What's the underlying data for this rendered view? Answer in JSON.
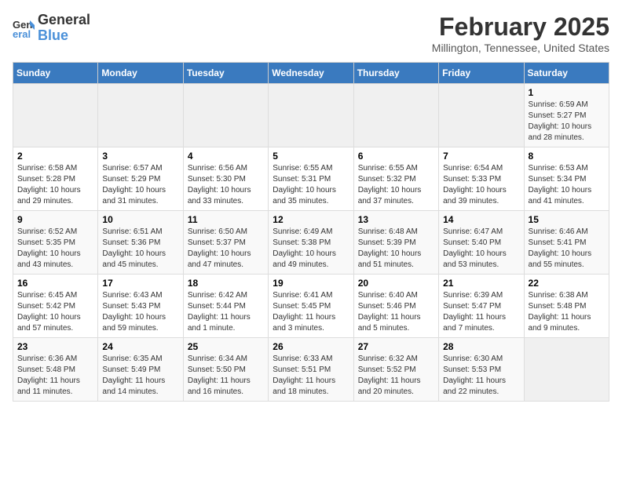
{
  "logo": {
    "line1": "General",
    "line2": "Blue"
  },
  "title": "February 2025",
  "subtitle": "Millington, Tennessee, United States",
  "days_of_week": [
    "Sunday",
    "Monday",
    "Tuesday",
    "Wednesday",
    "Thursday",
    "Friday",
    "Saturday"
  ],
  "weeks": [
    [
      {
        "day": "",
        "info": ""
      },
      {
        "day": "",
        "info": ""
      },
      {
        "day": "",
        "info": ""
      },
      {
        "day": "",
        "info": ""
      },
      {
        "day": "",
        "info": ""
      },
      {
        "day": "",
        "info": ""
      },
      {
        "day": "1",
        "info": "Sunrise: 6:59 AM\nSunset: 5:27 PM\nDaylight: 10 hours\nand 28 minutes."
      }
    ],
    [
      {
        "day": "2",
        "info": "Sunrise: 6:58 AM\nSunset: 5:28 PM\nDaylight: 10 hours\nand 29 minutes."
      },
      {
        "day": "3",
        "info": "Sunrise: 6:57 AM\nSunset: 5:29 PM\nDaylight: 10 hours\nand 31 minutes."
      },
      {
        "day": "4",
        "info": "Sunrise: 6:56 AM\nSunset: 5:30 PM\nDaylight: 10 hours\nand 33 minutes."
      },
      {
        "day": "5",
        "info": "Sunrise: 6:55 AM\nSunset: 5:31 PM\nDaylight: 10 hours\nand 35 minutes."
      },
      {
        "day": "6",
        "info": "Sunrise: 6:55 AM\nSunset: 5:32 PM\nDaylight: 10 hours\nand 37 minutes."
      },
      {
        "day": "7",
        "info": "Sunrise: 6:54 AM\nSunset: 5:33 PM\nDaylight: 10 hours\nand 39 minutes."
      },
      {
        "day": "8",
        "info": "Sunrise: 6:53 AM\nSunset: 5:34 PM\nDaylight: 10 hours\nand 41 minutes."
      }
    ],
    [
      {
        "day": "9",
        "info": "Sunrise: 6:52 AM\nSunset: 5:35 PM\nDaylight: 10 hours\nand 43 minutes."
      },
      {
        "day": "10",
        "info": "Sunrise: 6:51 AM\nSunset: 5:36 PM\nDaylight: 10 hours\nand 45 minutes."
      },
      {
        "day": "11",
        "info": "Sunrise: 6:50 AM\nSunset: 5:37 PM\nDaylight: 10 hours\nand 47 minutes."
      },
      {
        "day": "12",
        "info": "Sunrise: 6:49 AM\nSunset: 5:38 PM\nDaylight: 10 hours\nand 49 minutes."
      },
      {
        "day": "13",
        "info": "Sunrise: 6:48 AM\nSunset: 5:39 PM\nDaylight: 10 hours\nand 51 minutes."
      },
      {
        "day": "14",
        "info": "Sunrise: 6:47 AM\nSunset: 5:40 PM\nDaylight: 10 hours\nand 53 minutes."
      },
      {
        "day": "15",
        "info": "Sunrise: 6:46 AM\nSunset: 5:41 PM\nDaylight: 10 hours\nand 55 minutes."
      }
    ],
    [
      {
        "day": "16",
        "info": "Sunrise: 6:45 AM\nSunset: 5:42 PM\nDaylight: 10 hours\nand 57 minutes."
      },
      {
        "day": "17",
        "info": "Sunrise: 6:43 AM\nSunset: 5:43 PM\nDaylight: 10 hours\nand 59 minutes."
      },
      {
        "day": "18",
        "info": "Sunrise: 6:42 AM\nSunset: 5:44 PM\nDaylight: 11 hours\nand 1 minute."
      },
      {
        "day": "19",
        "info": "Sunrise: 6:41 AM\nSunset: 5:45 PM\nDaylight: 11 hours\nand 3 minutes."
      },
      {
        "day": "20",
        "info": "Sunrise: 6:40 AM\nSunset: 5:46 PM\nDaylight: 11 hours\nand 5 minutes."
      },
      {
        "day": "21",
        "info": "Sunrise: 6:39 AM\nSunset: 5:47 PM\nDaylight: 11 hours\nand 7 minutes."
      },
      {
        "day": "22",
        "info": "Sunrise: 6:38 AM\nSunset: 5:48 PM\nDaylight: 11 hours\nand 9 minutes."
      }
    ],
    [
      {
        "day": "23",
        "info": "Sunrise: 6:36 AM\nSunset: 5:48 PM\nDaylight: 11 hours\nand 11 minutes."
      },
      {
        "day": "24",
        "info": "Sunrise: 6:35 AM\nSunset: 5:49 PM\nDaylight: 11 hours\nand 14 minutes."
      },
      {
        "day": "25",
        "info": "Sunrise: 6:34 AM\nSunset: 5:50 PM\nDaylight: 11 hours\nand 16 minutes."
      },
      {
        "day": "26",
        "info": "Sunrise: 6:33 AM\nSunset: 5:51 PM\nDaylight: 11 hours\nand 18 minutes."
      },
      {
        "day": "27",
        "info": "Sunrise: 6:32 AM\nSunset: 5:52 PM\nDaylight: 11 hours\nand 20 minutes."
      },
      {
        "day": "28",
        "info": "Sunrise: 6:30 AM\nSunset: 5:53 PM\nDaylight: 11 hours\nand 22 minutes."
      },
      {
        "day": "",
        "info": ""
      }
    ]
  ]
}
